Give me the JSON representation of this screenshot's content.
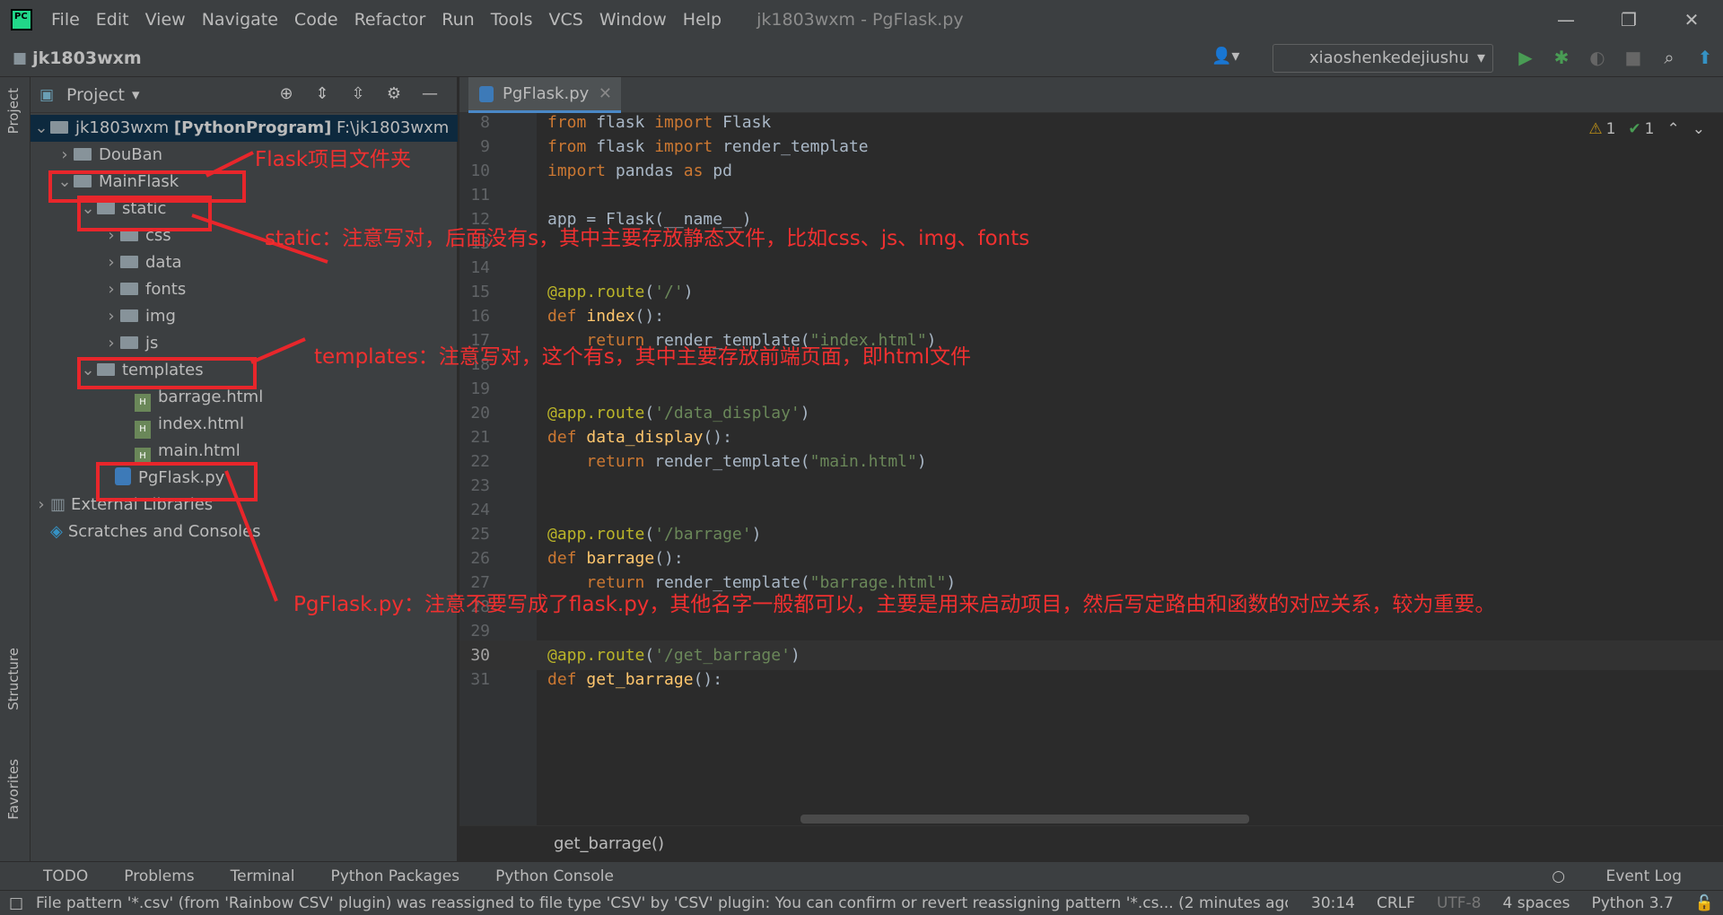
{
  "titlebar": {
    "menu": [
      "File",
      "Edit",
      "View",
      "Navigate",
      "Code",
      "Refactor",
      "Run",
      "Tools",
      "VCS",
      "Window",
      "Help"
    ],
    "window_title": "jk1803wxm - PgFlask.py"
  },
  "navbar": {
    "project": "jk1803wxm",
    "run_config": "xiaoshenkedejiushu"
  },
  "left_strip": {
    "project": "Project",
    "structure": "Structure",
    "favorites": "Favorites"
  },
  "project_panel": {
    "title": "Project"
  },
  "tree": {
    "root": {
      "name": "jk1803wxm",
      "tag": "[PythonProgram]",
      "path": "F:\\jk1803wxm"
    },
    "douban": "DouBan",
    "mainflask": "MainFlask",
    "static": "static",
    "css": "css",
    "data": "data",
    "fonts": "fonts",
    "img": "img",
    "js": "js",
    "templates": "templates",
    "barrage": "barrage.html",
    "index": "index.html",
    "main": "main.html",
    "pgflask": "PgFlask.py",
    "extlibs": "External Libraries",
    "scratches": "Scratches and Consoles"
  },
  "editor": {
    "tab": "PgFlask.py",
    "warnings": "1",
    "checks": "1",
    "breadcrumb": "get_barrage()",
    "lines": [
      {
        "n": "8",
        "code": "from flask import Flask"
      },
      {
        "n": "9",
        "code": "from flask import render_template"
      },
      {
        "n": "10",
        "code": "import pandas as pd"
      },
      {
        "n": "11",
        "code": ""
      },
      {
        "n": "12",
        "code": "app = Flask(__name__)"
      },
      {
        "n": "13",
        "code": ""
      },
      {
        "n": "14",
        "code": ""
      },
      {
        "n": "15",
        "code": "@app.route('/')"
      },
      {
        "n": "16",
        "code": "def index():"
      },
      {
        "n": "17",
        "code": "    return render_template(\"index.html\")"
      },
      {
        "n": "18",
        "code": ""
      },
      {
        "n": "19",
        "code": ""
      },
      {
        "n": "20",
        "code": "@app.route('/data_display')"
      },
      {
        "n": "21",
        "code": "def data_display():"
      },
      {
        "n": "22",
        "code": "    return render_template(\"main.html\")"
      },
      {
        "n": "23",
        "code": ""
      },
      {
        "n": "24",
        "code": ""
      },
      {
        "n": "25",
        "code": "@app.route('/barrage')"
      },
      {
        "n": "26",
        "code": "def barrage():"
      },
      {
        "n": "27",
        "code": "    return render_template(\"barrage.html\")"
      },
      {
        "n": "28",
        "code": ""
      },
      {
        "n": "29",
        "code": ""
      },
      {
        "n": "30",
        "code": "@app.route('/get_barrage')"
      },
      {
        "n": "31",
        "code": "def get_barrage():"
      }
    ]
  },
  "bottom_tabs": [
    "TODO",
    "Problems",
    "Terminal",
    "Python Packages",
    "Python Console"
  ],
  "event_log": "Event Log",
  "status": {
    "message": "File pattern '*.csv' (from 'Rainbow CSV' plugin) was reassigned to file type 'CSV' by 'CSV' plugin: You can confirm or revert reassigning pattern '*.cs... (2 minutes ago)",
    "pos": "30:14",
    "eol": "CRLF",
    "enc": "UTF-8",
    "indent": "4 spaces",
    "interp": "Python 3.7"
  },
  "annotations": {
    "flask": "Flask项目文件夹",
    "static": "static：注意写对，后面没有s，其中主要存放静态文件，比如css、js、img、fonts",
    "templates": "templates：注意写对，这个有s，其中主要存放前端页面，即html文件",
    "pgflask": "PgFlask.py：注意不要写成了flask.py，其他名字一般都可以，主要是用来启动项目，然后写定路由和函数的对应关系，较为重要。"
  },
  "colors": {
    "annotation": "#e8262b",
    "keyword": "#cc7832",
    "string": "#6a8759",
    "decorator": "#bbb529",
    "function": "#ffc66d"
  }
}
